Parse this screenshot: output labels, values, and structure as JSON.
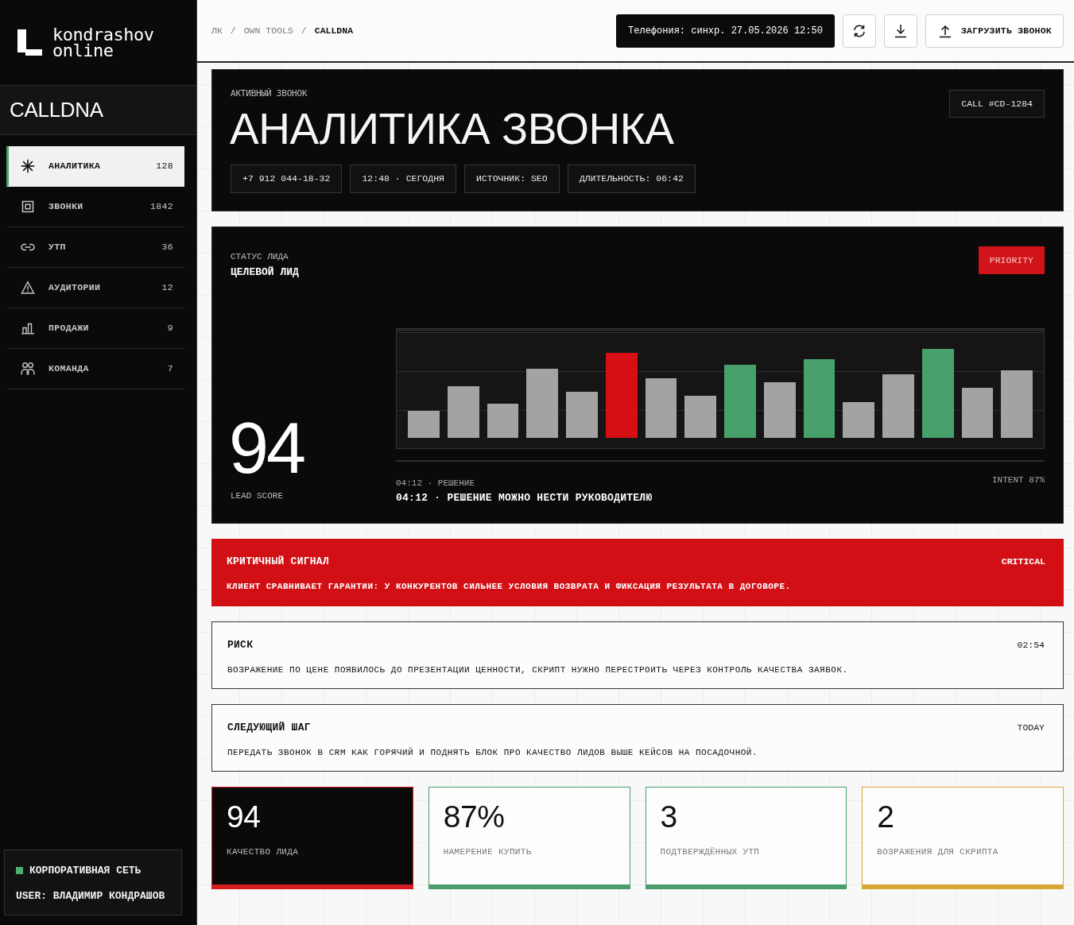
{
  "sidebar": {
    "logo": "kondrashov\nonline",
    "section_title": "CALLDNA",
    "items": [
      {
        "label": "АНАЛИТИКА",
        "count": "128",
        "selected": true
      },
      {
        "label": "ЗВОНКИ",
        "count": "1842",
        "selected": false
      },
      {
        "label": "УТП",
        "count": "36",
        "selected": false
      },
      {
        "label": "АУДИТОРИИ",
        "count": "12",
        "selected": false
      },
      {
        "label": "ПРОДАЖИ",
        "count": "9",
        "selected": false
      },
      {
        "label": "КОМАНДА",
        "count": "7",
        "selected": false
      }
    ],
    "network": {
      "label": "КОРПОРАТИВНАЯ СЕТЬ",
      "online": true
    },
    "user": "USER: ВЛАДИМИР КОНДРАШОВ"
  },
  "topbar": {
    "breadcrumb": [
      {
        "label": "ЛК",
        "current": false,
        "separator": "/"
      },
      {
        "label": "OWN TOOLS",
        "current": false,
        "separator": "/"
      },
      {
        "label": "CALLDNA",
        "current": true
      }
    ],
    "sync_status": "Телефония: синхр. 27.05.2026 12:50",
    "upload_button": "ЗАГРУЗИТЬ ЗВОНОК"
  },
  "call_header": {
    "eyebrow": "АКТИВНЫЙ ЗВОНОК",
    "title": "АНАЛИТИКА ЗВОНКА",
    "call_id": "CALL #CD-1284",
    "chips": [
      "+7 912 044-18-32",
      "12:48 · СЕГОДНЯ",
      "ИСТОЧНИК: SEO",
      "ДЛИТЕЛЬНОСТЬ: 06:42"
    ]
  },
  "lead": {
    "status_label": "СТАТУС ЛИДА",
    "status": "ЦЕЛЕВОЙ ЛИД",
    "badge": "PRIORITY",
    "score": "94",
    "score_label": "LEAD SCORE",
    "moment_label": "04:12 · РЕШЕНИЕ",
    "moment": "04:12 · РЕШЕНИЕ МОЖНО НЕСТИ РУКОВОДИТЕЛЮ",
    "intent": "INTENT 87%"
  },
  "signals": [
    {
      "kind": "critical",
      "title": "КРИТИЧНЫЙ СИГНАЛ",
      "tag": "CRITICAL",
      "text": "КЛИЕНТ СРАВНИВАЕТ ГАРАНТИИ: У КОНКУРЕНТОВ СИЛЬНЕЕ УСЛОВИЯ ВОЗВРАТА И ФИКСАЦИЯ РЕЗУЛЬТАТА В ДОГОВОРЕ."
    },
    {
      "kind": "note",
      "title": "РИСК",
      "tag": "02:54",
      "text": "ВОЗРАЖЕНИЕ ПО ЦЕНЕ ПОЯВИЛОСЬ ДО ПРЕЗЕНТАЦИИ ЦЕННОСТИ, СКРИПТ НУЖНО ПЕРЕСТРОИТЬ ЧЕРЕЗ КОНТРОЛЬ КАЧЕСТВА ЗАЯВОК."
    },
    {
      "kind": "note",
      "title": "СЛЕДУЮЩИЙ ШАГ",
      "tag": "TODAY",
      "text": "ПЕРЕДАТЬ ЗВОНОК В CRM КАК ГОРЯЧИЙ И ПОДНЯТЬ БЛОК ПРО КАЧЕСТВО ЛИДОВ ВЫШЕ КЕЙСОВ НА ПОСАДОЧНОЙ."
    }
  ],
  "stats": [
    {
      "value": "94",
      "label": "КАЧЕСТВО ЛИДА",
      "color": "#d71a20",
      "highlighted": true
    },
    {
      "value": "87%",
      "label": "НАМЕРЕНИЕ КУПИТЬ",
      "color": "#4a9e6b",
      "highlighted": false
    },
    {
      "value": "3",
      "label": "ПОДТВЕРЖДЁННЫХ УТП",
      "color": "#4a9e6b",
      "highlighted": false
    },
    {
      "value": "2",
      "label": "ВОЗРАЖЕНИЯ ДЛЯ СКРИПТА",
      "color": "#d9a536",
      "highlighted": false
    }
  ]
}
